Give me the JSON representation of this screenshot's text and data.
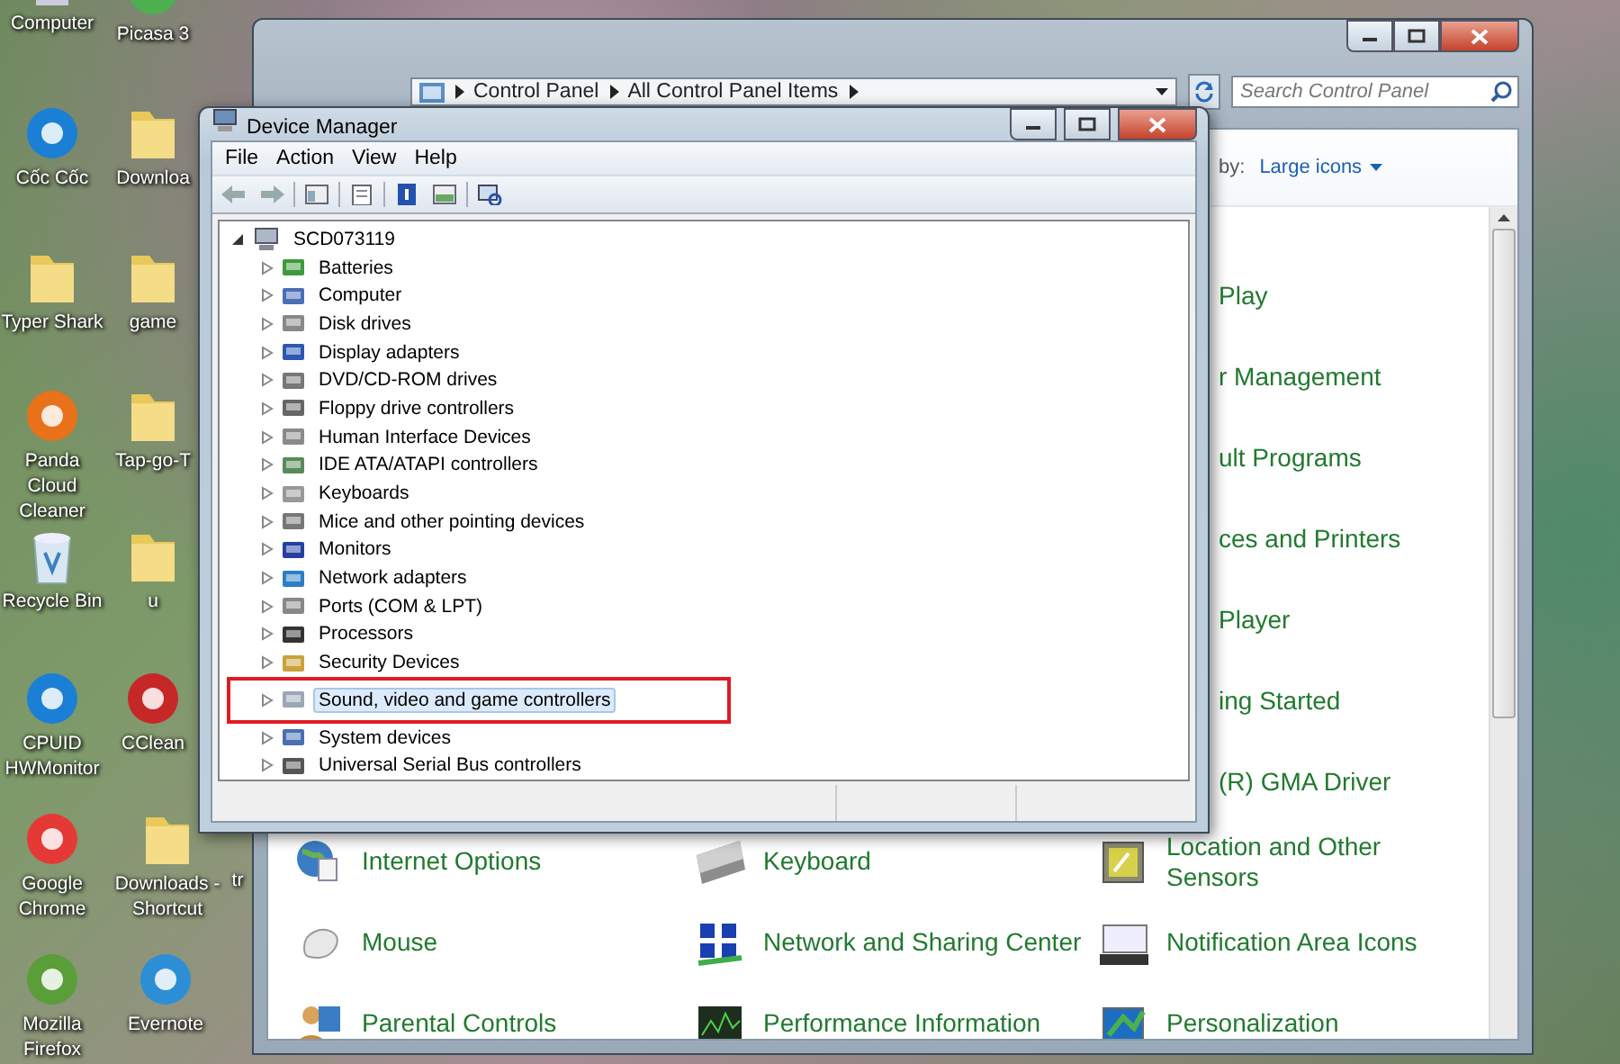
{
  "desktop_icons": [
    {
      "label": "Computer",
      "kind": "computer"
    },
    {
      "label": "Picasa 3",
      "kind": "app"
    },
    {
      "label": "Cốc Cốc",
      "kind": "app"
    },
    {
      "label": "Downloa",
      "kind": "folder"
    },
    {
      "label": "Typer Shark",
      "kind": "folder"
    },
    {
      "label": "game",
      "kind": "folder"
    },
    {
      "label": "Panda Cloud Cleaner",
      "kind": "app"
    },
    {
      "label": "Tap-go-T",
      "kind": "folder"
    },
    {
      "label": "Recycle Bin",
      "kind": "recycle_bin"
    },
    {
      "label": "u",
      "kind": "folder"
    },
    {
      "label": "CPUID HWMonitor",
      "kind": "app"
    },
    {
      "label": "CClean",
      "kind": "app"
    },
    {
      "label": "Google Chrome",
      "kind": "app"
    },
    {
      "label": "Downloads - Shortcut",
      "kind": "folder"
    },
    {
      "label": "tr",
      "kind": "label_only"
    },
    {
      "label": "Mozilla Firefox",
      "kind": "app"
    },
    {
      "label": "Evernote",
      "kind": "app"
    }
  ],
  "control_panel": {
    "breadcrumb": [
      "Control Panel",
      "All Control Panel Items"
    ],
    "search": {
      "placeholder": "Search Control Panel"
    },
    "view_by": {
      "label": "by:",
      "value": "Large icons"
    },
    "covered_items": [
      "Play",
      "r Management",
      "ult Programs",
      "ces and Printers",
      "Player",
      "ing Started",
      "(R) GMA Driver"
    ],
    "items": [
      {
        "label": "Internet Options",
        "kind": "globe"
      },
      {
        "label": "Keyboard",
        "kind": "keyboard"
      },
      {
        "label": "Location and Other Sensors",
        "kind": "sensor"
      },
      {
        "label": "Mouse",
        "kind": "mouse"
      },
      {
        "label": "Network and Sharing Center",
        "kind": "network"
      },
      {
        "label": "Notification Area Icons",
        "kind": "notification"
      },
      {
        "label": "Parental Controls",
        "kind": "people"
      },
      {
        "label": "Performance Information",
        "kind": "chart"
      },
      {
        "label": "Personalization",
        "kind": "display"
      }
    ]
  },
  "device_manager": {
    "title": "Device Manager",
    "menu": [
      "File",
      "Action",
      "View",
      "Help"
    ],
    "tree": {
      "label": "SCD073119",
      "expanded": true,
      "children": [
        {
          "label": "Batteries",
          "expanded": false,
          "selected": false,
          "marked": false
        },
        {
          "label": "Computer",
          "expanded": false,
          "selected": false,
          "marked": false
        },
        {
          "label": "Disk drives",
          "expanded": false,
          "selected": false,
          "marked": false
        },
        {
          "label": "Display adapters",
          "expanded": false,
          "selected": false,
          "marked": false
        },
        {
          "label": "DVD/CD-ROM drives",
          "expanded": false,
          "selected": false,
          "marked": false
        },
        {
          "label": "Floppy drive controllers",
          "expanded": false,
          "selected": false,
          "marked": false
        },
        {
          "label": "Human Interface Devices",
          "expanded": false,
          "selected": false,
          "marked": false
        },
        {
          "label": "IDE ATA/ATAPI controllers",
          "expanded": false,
          "selected": false,
          "marked": false
        },
        {
          "label": "Keyboards",
          "expanded": false,
          "selected": false,
          "marked": false
        },
        {
          "label": "Mice and other pointing devices",
          "expanded": false,
          "selected": false,
          "marked": false
        },
        {
          "label": "Monitors",
          "expanded": false,
          "selected": false,
          "marked": false
        },
        {
          "label": "Network adapters",
          "expanded": false,
          "selected": false,
          "marked": false
        },
        {
          "label": "Ports (COM & LPT)",
          "expanded": false,
          "selected": false,
          "marked": false
        },
        {
          "label": "Processors",
          "expanded": false,
          "selected": false,
          "marked": false
        },
        {
          "label": "Security Devices",
          "expanded": false,
          "selected": false,
          "marked": false
        },
        {
          "label": "Sound, video and game controllers",
          "expanded": false,
          "selected": true,
          "marked": true
        },
        {
          "label": "System devices",
          "expanded": false,
          "selected": false,
          "marked": false
        },
        {
          "label": "Universal Serial Bus controllers",
          "expanded": false,
          "selected": false,
          "marked": false
        }
      ]
    }
  }
}
